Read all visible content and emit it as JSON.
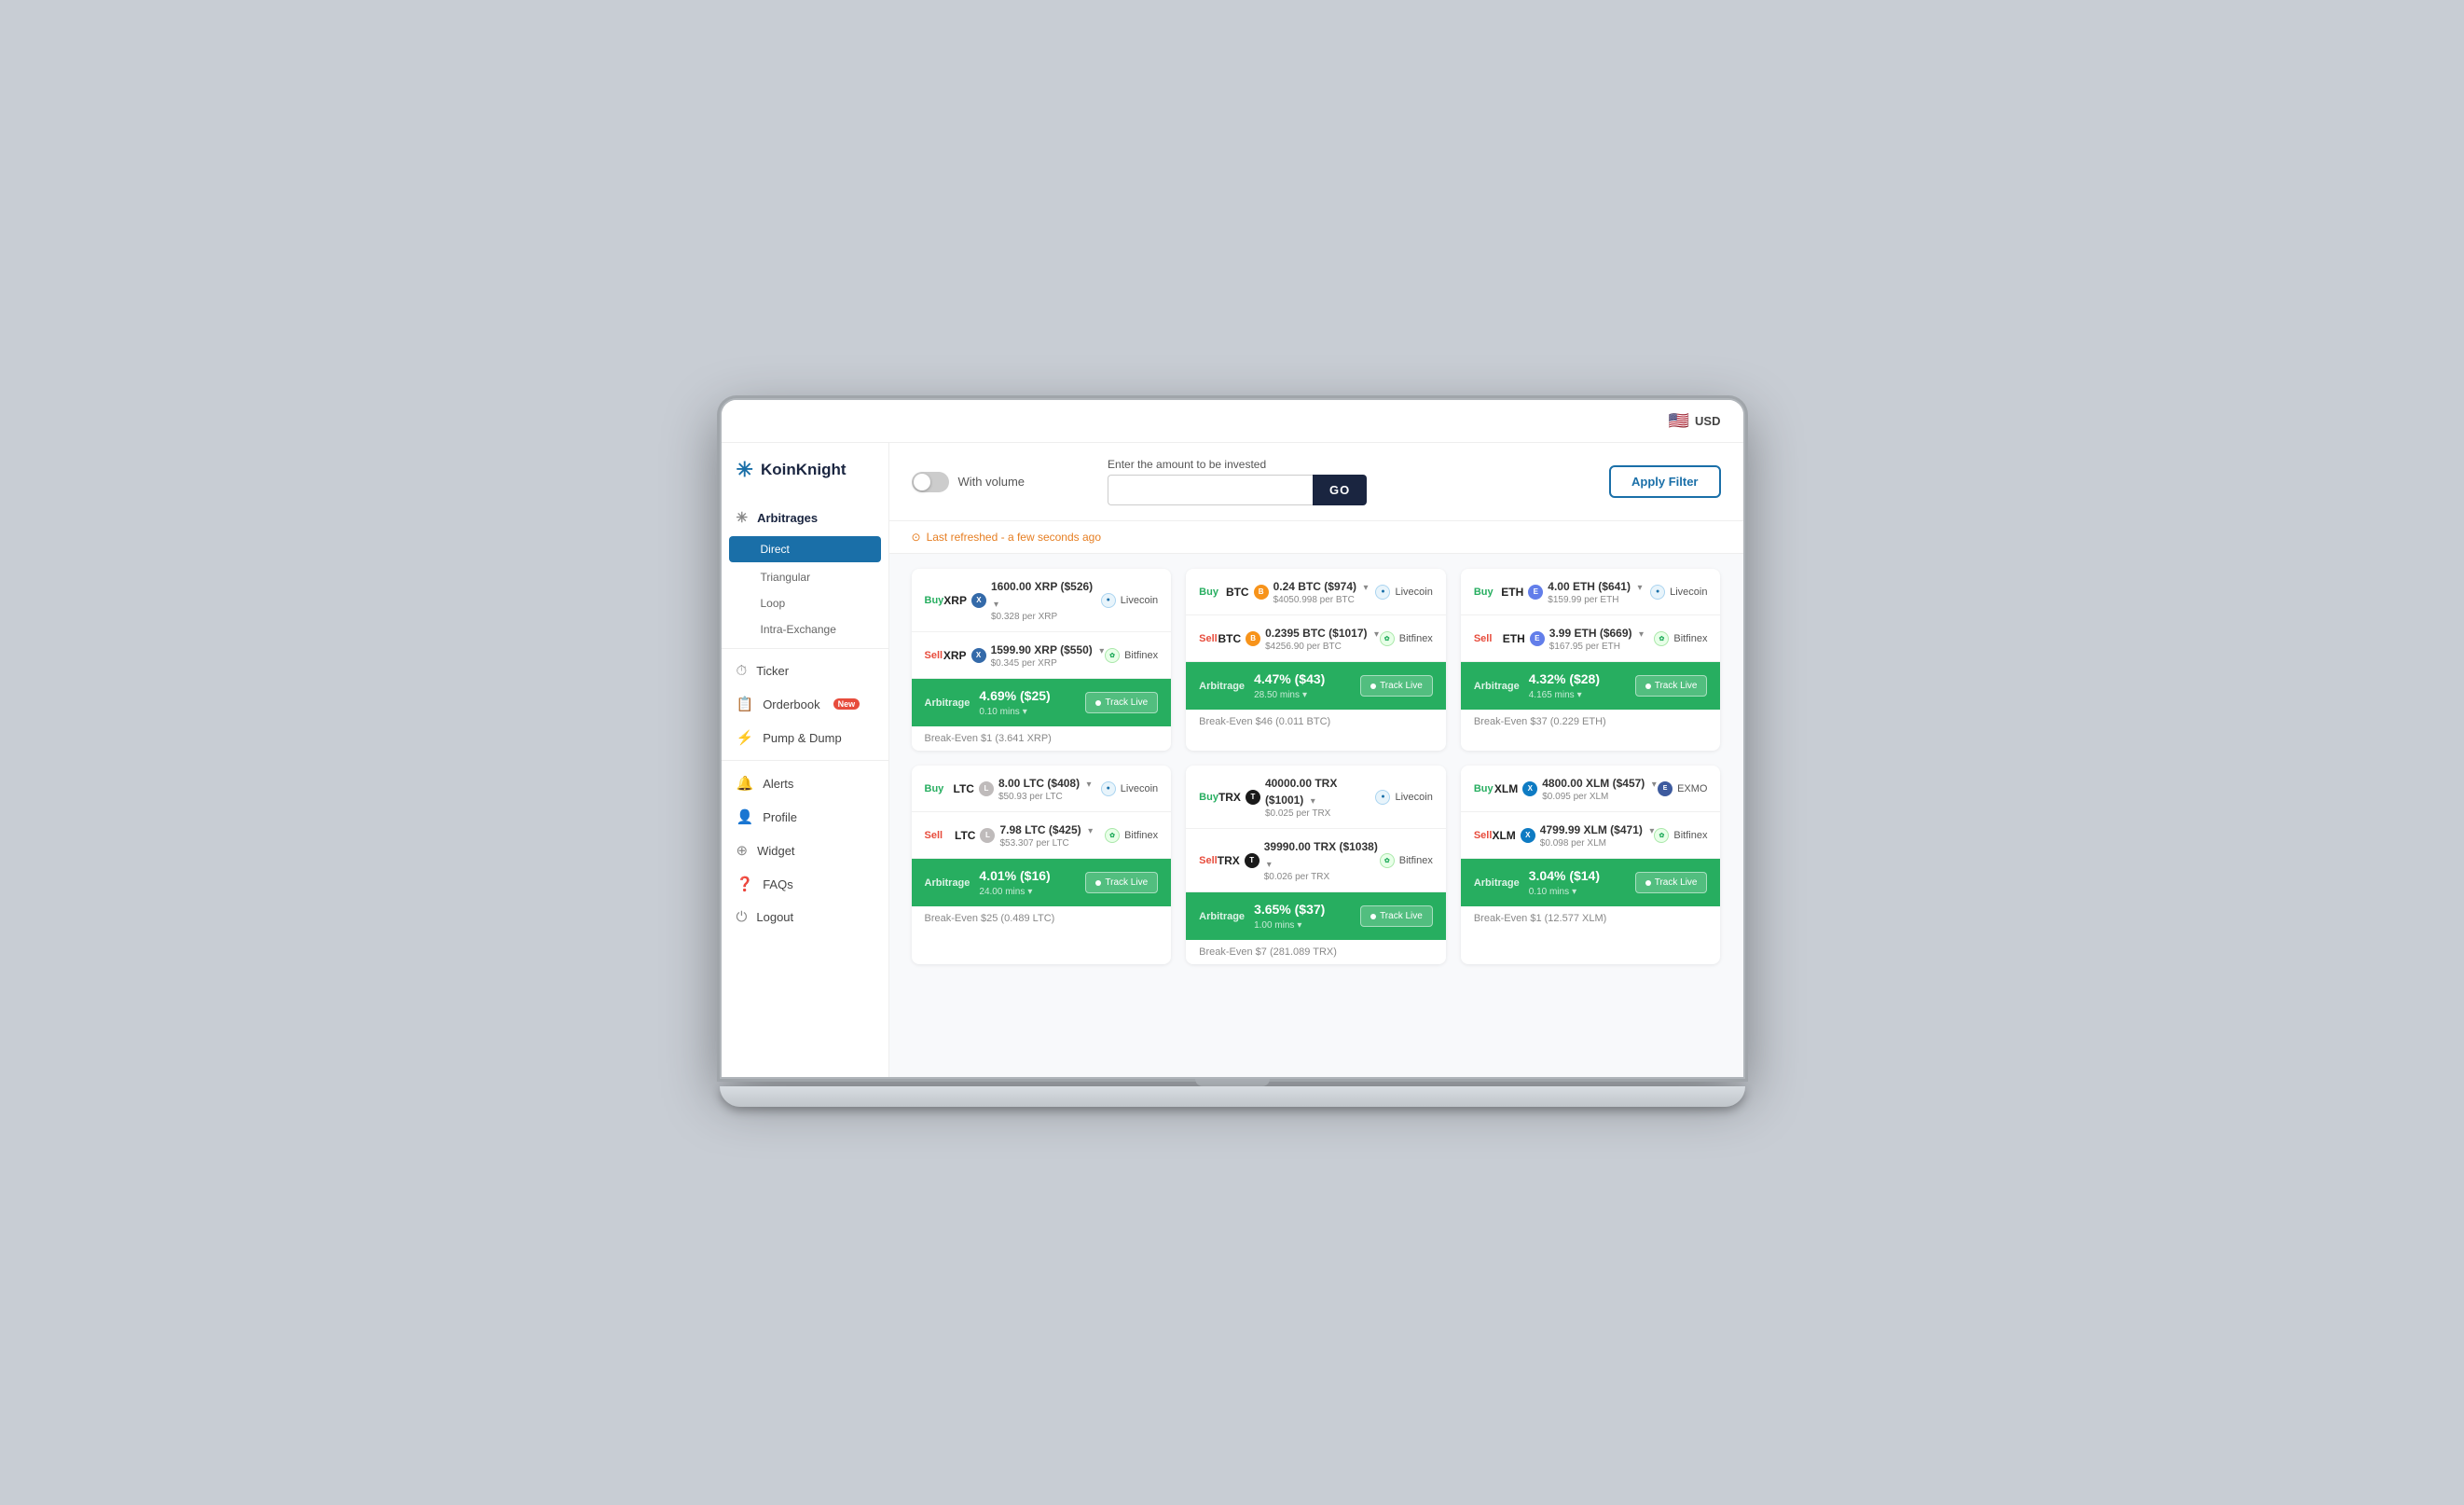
{
  "app": {
    "title": "KoinKnight",
    "currency": "USD"
  },
  "sidebar": {
    "logo_icon": "✳",
    "items": [
      {
        "id": "arbitrages",
        "label": "Arbitrages",
        "icon": "✳",
        "active": true,
        "subitems": [
          {
            "id": "direct",
            "label": "Direct",
            "active": true
          },
          {
            "id": "triangular",
            "label": "Triangular",
            "active": false
          },
          {
            "id": "loop",
            "label": "Loop",
            "active": false
          },
          {
            "id": "intra-exchange",
            "label": "Intra-Exchange",
            "active": false
          }
        ]
      },
      {
        "id": "ticker",
        "label": "Ticker",
        "icon": "⏱",
        "active": false
      },
      {
        "id": "orderbook",
        "label": "Orderbook",
        "icon": "📋",
        "badge": "New",
        "active": false
      },
      {
        "id": "pump-dump",
        "label": "Pump & Dump",
        "icon": "⚡",
        "active": false
      },
      {
        "id": "alerts",
        "label": "Alerts",
        "icon": "🔔",
        "active": false
      },
      {
        "id": "profile",
        "label": "Profile",
        "icon": "👤",
        "active": false
      },
      {
        "id": "widget",
        "label": "Widget",
        "icon": "⊕",
        "active": false
      },
      {
        "id": "faqs",
        "label": "FAQs",
        "icon": "❓",
        "active": false
      },
      {
        "id": "logout",
        "label": "Logout",
        "icon": "⏻",
        "active": false
      }
    ]
  },
  "header": {
    "currency_flag": "🇺🇸",
    "currency_label": "USD"
  },
  "controls": {
    "toggle_label": "With volume",
    "invest_label": "Enter the amount to be invested",
    "invest_placeholder": "",
    "go_label": "GO",
    "apply_filter_label": "Apply Filter"
  },
  "refresh": {
    "text": "Last refreshed - a few seconds ago"
  },
  "cards": [
    {
      "buy": {
        "label": "Buy",
        "coin": "XRP",
        "amount": "1600.00 XRP ($526)",
        "price": "$0.328 per XRP",
        "exchange": "Livecoin",
        "coin_class": "coin-xrp"
      },
      "sell": {
        "label": "Sell",
        "coin": "XRP",
        "amount": "1599.90 XRP ($550)",
        "price": "$0.345 per XRP",
        "exchange": "Bitfinex",
        "coin_class": "coin-xrp"
      },
      "arbitrage": {
        "label": "Arbitrage",
        "percent": "4.69% ($25)",
        "mins": "0.10 mins",
        "break_even": "Break-Even  $1 (3.641 XRP)"
      }
    },
    {
      "buy": {
        "label": "Buy",
        "coin": "BTC",
        "amount": "0.24 BTC ($974)",
        "price": "$4050.998 per BTC",
        "exchange": "Livecoin",
        "coin_class": "coin-btc"
      },
      "sell": {
        "label": "Sell",
        "coin": "BTC",
        "amount": "0.2395 BTC ($1017)",
        "price": "$4256.90 per BTC",
        "exchange": "Bitfinex",
        "coin_class": "coin-btc"
      },
      "arbitrage": {
        "label": "Arbitrage",
        "percent": "4.47% ($43)",
        "mins": "28.50 mins",
        "break_even": "Break-Even  $46 (0.011 BTC)"
      }
    },
    {
      "buy": {
        "label": "Buy",
        "coin": "ETH",
        "amount": "4.00 ETH ($641)",
        "price": "$159.99 per ETH",
        "exchange": "Livecoin",
        "coin_class": "coin-eth"
      },
      "sell": {
        "label": "Sell",
        "coin": "ETH",
        "amount": "3.99 ETH ($669)",
        "price": "$167.95 per ETH",
        "exchange": "Bitfinex",
        "coin_class": "coin-eth"
      },
      "arbitrage": {
        "label": "Arbitrage",
        "percent": "4.32% ($28)",
        "mins": "4.165 mins",
        "break_even": "Break-Even  $37 (0.229 ETH)"
      }
    },
    {
      "buy": {
        "label": "Buy",
        "coin": "LTC",
        "amount": "8.00 LTC ($408)",
        "price": "$50.93 per LTC",
        "exchange": "Livecoin",
        "coin_class": "coin-ltc"
      },
      "sell": {
        "label": "Sell",
        "coin": "LTC",
        "amount": "7.98 LTC ($425)",
        "price": "$53.307 per LTC",
        "exchange": "Bitfinex",
        "coin_class": "coin-ltc"
      },
      "arbitrage": {
        "label": "Arbitrage",
        "percent": "4.01% ($16)",
        "mins": "24.00 mins",
        "break_even": "Break-Even  $25 (0.489 LTC)"
      }
    },
    {
      "buy": {
        "label": "Buy",
        "coin": "TRX",
        "amount": "40000.00 TRX ($1001)",
        "price": "$0.025 per TRX",
        "exchange": "Livecoin",
        "coin_class": "coin-trx"
      },
      "sell": {
        "label": "Sell",
        "coin": "TRX",
        "amount": "39990.00 TRX ($1038)",
        "price": "$0.026 per TRX",
        "exchange": "Bitfinex",
        "coin_class": "coin-trx"
      },
      "arbitrage": {
        "label": "Arbitrage",
        "percent": "3.65% ($37)",
        "mins": "1.00 mins",
        "break_even": "Break-Even  $7 (281.089 TRX)"
      }
    },
    {
      "buy": {
        "label": "Buy",
        "coin": "XLM",
        "amount": "4800.00 XLM ($457)",
        "price": "$0.095 per XLM",
        "exchange": "EXMO",
        "coin_class": "coin-xlm"
      },
      "sell": {
        "label": "Sell",
        "coin": "XLM",
        "amount": "4799.99 XLM ($471)",
        "price": "$0.098 per XLM",
        "exchange": "Bitfinex",
        "coin_class": "coin-xlm"
      },
      "arbitrage": {
        "label": "Arbitrage",
        "percent": "3.04% ($14)",
        "mins": "0.10 mins",
        "break_even": "Break-Even  $1 (12.577 XLM)"
      }
    }
  ]
}
